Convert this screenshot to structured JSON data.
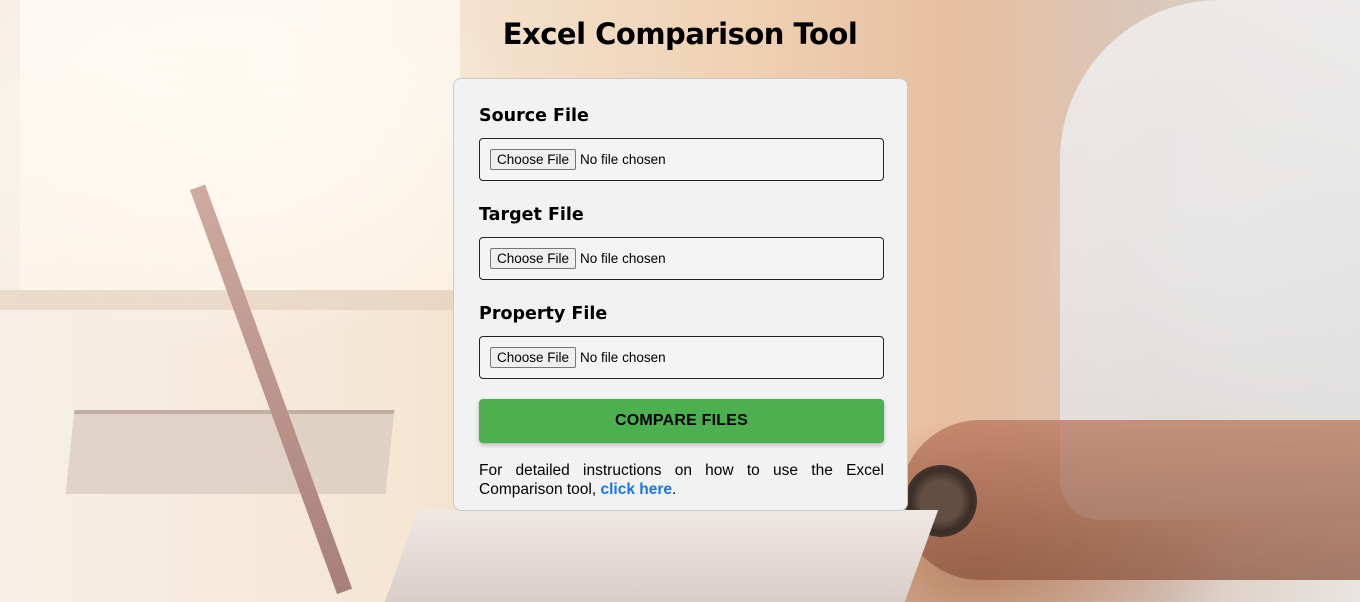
{
  "page": {
    "title": "Excel Comparison Tool"
  },
  "form": {
    "fields": [
      {
        "label": "Source File",
        "button_label": "Choose File",
        "status": "No file chosen"
      },
      {
        "label": "Target File",
        "button_label": "Choose File",
        "status": "No file chosen"
      },
      {
        "label": "Property File",
        "button_label": "Choose File",
        "status": "No file chosen"
      }
    ],
    "submit_label": "COMPARE FILES",
    "instructions_prefix": "For detailed instructions on how to use the Excel Comparison tool, ",
    "instructions_link": "click here",
    "instructions_suffix": "."
  },
  "colors": {
    "accent_button": "#4caf50",
    "link": "#1a73e8",
    "card_background": "#f2f2f2"
  }
}
